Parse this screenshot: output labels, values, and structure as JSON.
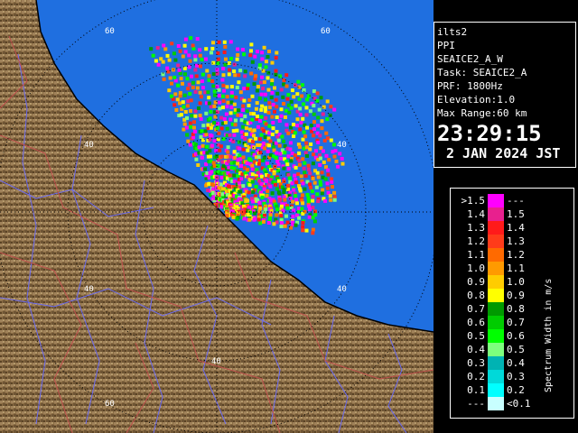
{
  "info": {
    "site": "ilts2",
    "scan_type": "PPI",
    "product": "SEAICE2_A_W",
    "task": "Task: SEAICE2_A",
    "prf": "PRF: 1800Hz",
    "elevation": "Elevation:1.0",
    "max_range": "Max Range:60 km",
    "time": "23:29:15",
    "date": "2 JAN 2024 JST"
  },
  "range_labels": {
    "r60_top_left": "60",
    "r60_top_right": "60",
    "r40_upper_left": "40",
    "r40_right": "40",
    "r40_lower_left": "40",
    "r40_right_lower": "40",
    "r40_bottom": "40",
    "r60_bottom": "60"
  },
  "legend": {
    "title": "Spectrum Width in m/s",
    "rows": [
      {
        "lo": ">1.5",
        "hi": "---",
        "color": "#ff00ff"
      },
      {
        "lo": "1.4",
        "hi": "1.5",
        "color": "#e8208e"
      },
      {
        "lo": "1.3",
        "hi": "1.4",
        "color": "#ff1a1a"
      },
      {
        "lo": "1.2",
        "hi": "1.3",
        "color": "#ff3b1a"
      },
      {
        "lo": "1.1",
        "hi": "1.2",
        "color": "#ff6a00"
      },
      {
        "lo": "1.0",
        "hi": "1.1",
        "color": "#ff9a00"
      },
      {
        "lo": "0.9",
        "hi": "1.0",
        "color": "#ffcc00"
      },
      {
        "lo": "0.8",
        "hi": "0.9",
        "color": "#ffff00"
      },
      {
        "lo": "0.7",
        "hi": "0.8",
        "color": "#009a00"
      },
      {
        "lo": "0.6",
        "hi": "0.7",
        "color": "#00cc00"
      },
      {
        "lo": "0.5",
        "hi": "0.6",
        "color": "#00ff00"
      },
      {
        "lo": "0.4",
        "hi": "0.5",
        "color": "#7dff7d"
      },
      {
        "lo": "0.3",
        "hi": "0.4",
        "color": "#00b3b3"
      },
      {
        "lo": "0.2",
        "hi": "0.3",
        "color": "#00d9d9"
      },
      {
        "lo": "0.1",
        "hi": "0.2",
        "color": "#00ffff"
      },
      {
        "lo": "---",
        "hi": "<0.1",
        "color": "#c8ffff"
      }
    ]
  },
  "colors": {
    "sea": "#1f6fe0",
    "land": "#8a6c44",
    "land_dark": "#5a4325",
    "land_light": "#b59a6c",
    "coast": "#000000",
    "river": "#6a6af0",
    "boundary": "#c0504d",
    "ring": "#000000"
  }
}
